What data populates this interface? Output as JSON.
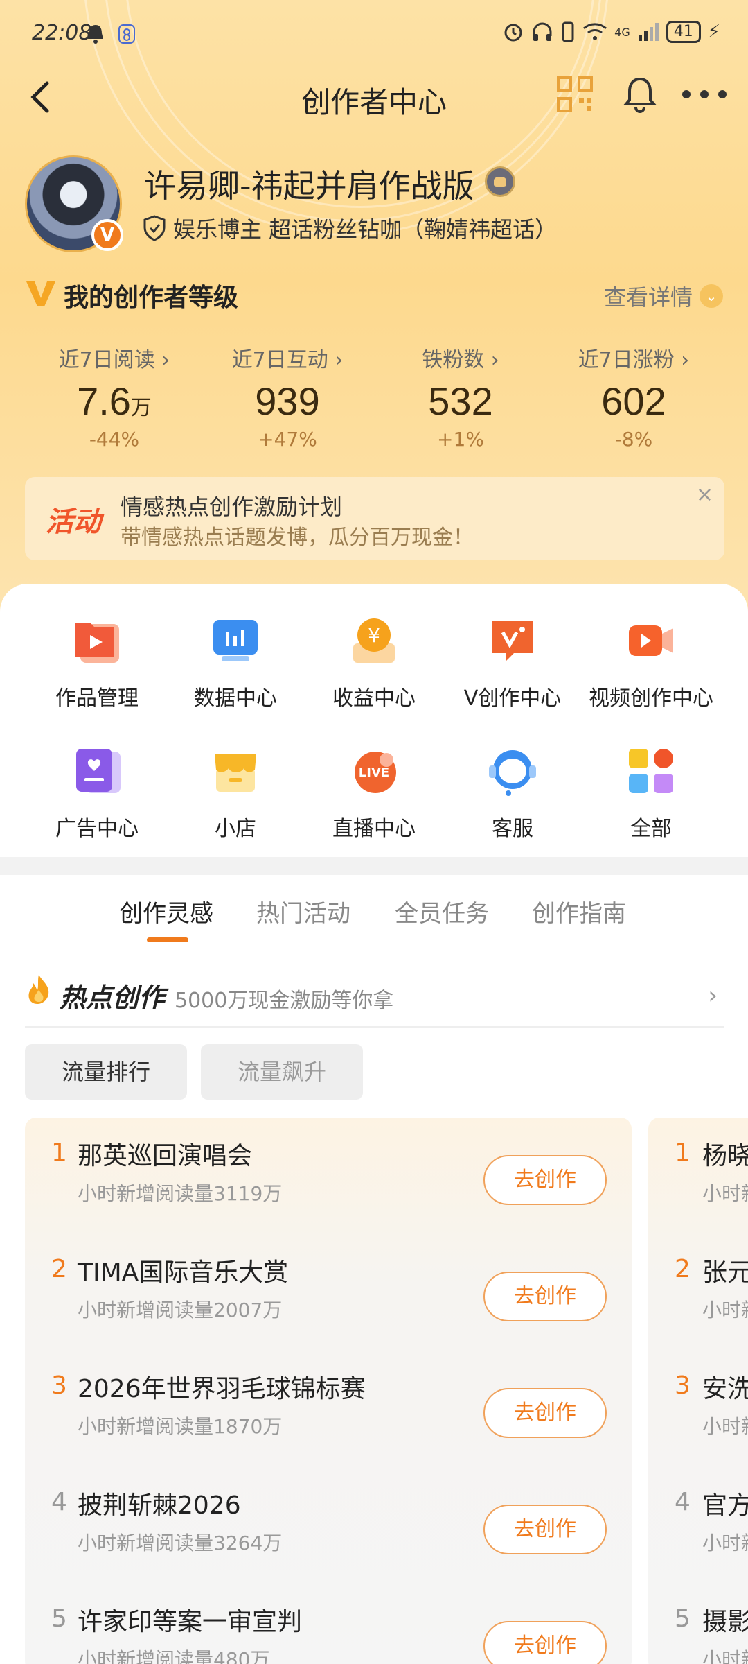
{
  "status_bar": {
    "time": "22:08",
    "network": "4G",
    "battery": "41"
  },
  "nav": {
    "title": "创作者中心"
  },
  "profile": {
    "username": "许易卿-祎起并肩作战版",
    "verify_text": "娱乐博主 超话粉丝钻咖（鞠婧祎超话）",
    "avatar_badge": "V"
  },
  "level": {
    "title": "我的创作者等级",
    "more": "查看详情"
  },
  "stats": [
    {
      "label": "近7日阅读 ›",
      "value": "7.6",
      "unit": "万",
      "change": "-44%"
    },
    {
      "label": "近7日互动 ›",
      "value": "939",
      "unit": "",
      "change": "+47%"
    },
    {
      "label": "铁粉数 ›",
      "value": "532",
      "unit": "",
      "change": "+1%"
    },
    {
      "label": "近7日涨粉 ›",
      "value": "602",
      "unit": "",
      "change": "-8%"
    }
  ],
  "activity": {
    "tag": "活动",
    "title": "情感热点创作激励计划",
    "subtitle": "带情感热点话题发博，瓜分百万现金！",
    "close": "×"
  },
  "tools": [
    {
      "label": "作品管理",
      "icon": "works-icon"
    },
    {
      "label": "数据中心",
      "icon": "data-icon"
    },
    {
      "label": "收益中心",
      "icon": "income-icon"
    },
    {
      "label": "V创作中心",
      "icon": "v-create-icon"
    },
    {
      "label": "视频创作中心",
      "icon": "video-icon"
    },
    {
      "label": "广告中心",
      "icon": "ad-icon"
    },
    {
      "label": "小店",
      "icon": "shop-icon"
    },
    {
      "label": "直播中心",
      "icon": "live-icon"
    },
    {
      "label": "客服",
      "icon": "service-icon"
    },
    {
      "label": "全部",
      "icon": "all-icon"
    }
  ],
  "tabs": [
    "创作灵感",
    "热门活动",
    "全员任务",
    "创作指南"
  ],
  "hot": {
    "title": "热点创作",
    "subtitle": "5000万现金激励等你拿"
  },
  "filters": [
    "流量排行",
    "流量飙升"
  ],
  "ranking": [
    {
      "rank": "1",
      "title": "那英巡回演唱会",
      "sub": "小时新增阅读量3119万",
      "button": "去创作"
    },
    {
      "rank": "2",
      "title": "TIMA国际音乐大赏",
      "sub": "小时新增阅读量2007万",
      "button": "去创作"
    },
    {
      "rank": "3",
      "title": "2026年世界羽毛球锦标赛",
      "sub": "小时新增阅读量1870万",
      "button": "去创作"
    },
    {
      "rank": "4",
      "title": "披荆斩棘2026",
      "sub": "小时新增阅读量3264万",
      "button": "去创作"
    },
    {
      "rank": "5",
      "title": "许家印等案一审宣判",
      "sub": "小时新增阅读量480万",
      "button": "去创作"
    }
  ],
  "ranking2": [
    {
      "rank": "1",
      "title": "杨晓",
      "sub": "小时新"
    },
    {
      "rank": "2",
      "title": "张元",
      "sub": "小时新"
    },
    {
      "rank": "3",
      "title": "安洗",
      "sub": "小时新"
    },
    {
      "rank": "4",
      "title": "官方",
      "sub": "小时新"
    },
    {
      "rank": "5",
      "title": "摄影",
      "sub": "小时新"
    }
  ],
  "colors": {
    "accent": "#f07a1c",
    "rank_top": "#f07a1c",
    "rank_other": "#999999"
  }
}
